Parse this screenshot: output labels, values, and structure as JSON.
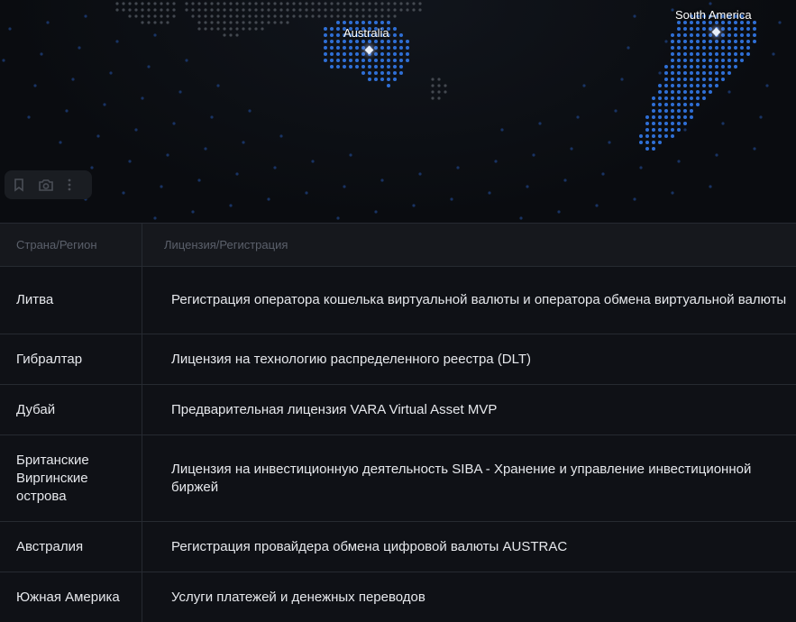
{
  "map": {
    "labels": {
      "australia": "Australia",
      "south_america": "South America"
    },
    "colors": {
      "land_grey": "#5a5f68",
      "land_blue": "#2f6fd6",
      "ocean_dot": "#1d3d78"
    }
  },
  "toolbar": {
    "icons": [
      "bookmark-icon",
      "camera-icon",
      "more-vertical-icon"
    ]
  },
  "table": {
    "headers": {
      "region": "Страна/Регион",
      "license": "Лицензия/Регистрация"
    },
    "rows": [
      {
        "region": "Литва",
        "license": "Регистрация оператора кошелька виртуальной валюты и оператора обмена виртуальной валюты"
      },
      {
        "region": "Гибралтар",
        "license": "Лицензия на технологию распределенного реестра (DLT)"
      },
      {
        "region": "Дубай",
        "license": "Предварительная лицензия VARA Virtual Asset MVP"
      },
      {
        "region": "Британские Виргинские острова",
        "license": "Лицензия на инвестиционную деятельность SIBA - Хранение и управление инвестиционной биржей"
      },
      {
        "region": "Австралия",
        "license": "Регистрация провайдера обмена цифровой валюты AUSTRAC"
      },
      {
        "region": "Южная Америка",
        "license": "Услуги платежей и денежных переводов"
      }
    ]
  }
}
